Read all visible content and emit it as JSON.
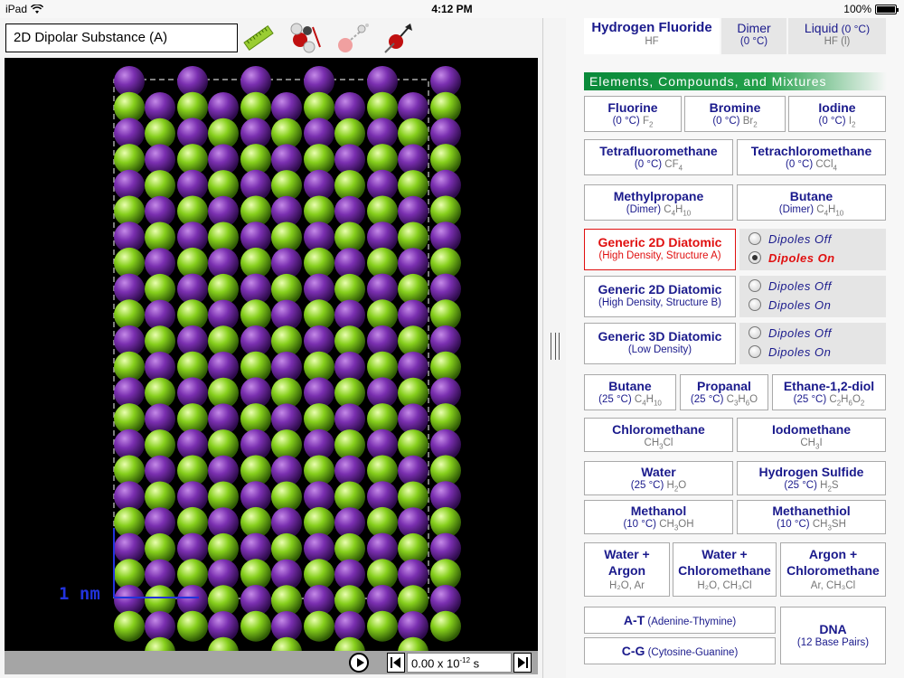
{
  "status": {
    "device": "iPad",
    "time": "4:12 PM",
    "battery": "100%"
  },
  "left": {
    "title": "2D Dipolar Substance (A)",
    "scale_label": "1 nm",
    "time_value": "0.00 x 10",
    "time_exp": "-12",
    "time_unit": " s"
  },
  "top_row": [
    {
      "name": "Hydrogen Fluoride",
      "sub": "HF"
    },
    {
      "name": "Dimer",
      "sub": "(0 °C)"
    },
    {
      "name": "Liquid",
      "name_extra": " (0 °C)",
      "sub": "HF (l)"
    }
  ],
  "section_title": "Elements, Compounds, and Mixtures",
  "row1": [
    {
      "name": "Fluorine",
      "cond": "(0 °C)",
      "f1": "F",
      "f1s": "2"
    },
    {
      "name": "Bromine",
      "cond": "(0 °C)",
      "f1": "Br",
      "f1s": "2"
    },
    {
      "name": "Iodine",
      "cond": "(0 °C)",
      "f1": "I",
      "f1s": "2"
    }
  ],
  "row2": [
    {
      "name": "Tetrafluoromethane",
      "cond": "(0 °C)",
      "f1": "CF",
      "f1s": "4"
    },
    {
      "name": "Tetrachloromethane",
      "cond": "(0 °C)",
      "f1": "CCl",
      "f1s": "4"
    }
  ],
  "row3": [
    {
      "name": "Methylpropane",
      "cond": "(Dimer)",
      "f1": "C",
      "f1s": "4",
      "f2": "H",
      "f2s": "10"
    },
    {
      "name": "Butane",
      "cond": "(Dimer)",
      "f1": "C",
      "f1s": "4",
      "f2": "H",
      "f2s": "10"
    }
  ],
  "diatomic": [
    {
      "name": "Generic 2D Diatomic",
      "sub": "(High Density, Structure A)",
      "off": "Dipoles Off",
      "on": "Dipoles On"
    },
    {
      "name": "Generic 2D Diatomic",
      "sub": "(High Density, Structure B)",
      "off": "Dipoles Off",
      "on": "Dipoles On"
    },
    {
      "name": "Generic 3D Diatomic",
      "sub": "(Low Density)",
      "off": "Dipoles Off",
      "on": "Dipoles On"
    }
  ],
  "row4": [
    {
      "name": "Butane",
      "cond": "(25 °C)",
      "f1": "C",
      "f1s": "4",
      "f2": "H",
      "f2s": "10"
    },
    {
      "name": "Propanal",
      "cond": "(25 °C)",
      "f1": "C",
      "f1s": "3",
      "f2": "H",
      "f2s": "6",
      "f3": "O"
    },
    {
      "name": "Ethane-1,2-diol",
      "cond": "(25 °C)",
      "f1": "C",
      "f1s": "2",
      "f2": "H",
      "f2s": "6",
      "f3": "O",
      "f3s": "2"
    }
  ],
  "row5": [
    {
      "name": "Chloromethane",
      "f1": "CH",
      "f1s": "3",
      "f2": "Cl"
    },
    {
      "name": "Iodomethane",
      "f1": "CH",
      "f1s": "3",
      "f2": "I"
    }
  ],
  "row6": [
    {
      "name": "Water",
      "cond": "(25 °C)",
      "f1": "H",
      "f1s": "2",
      "f2": "O"
    },
    {
      "name": "Hydrogen Sulfide",
      "cond": "(25 °C)",
      "f1": "H",
      "f1s": "2",
      "f2": "S"
    }
  ],
  "row7": [
    {
      "name": "Methanol",
      "cond": "(10 °C)",
      "f1": "CH",
      "f1s": "3",
      "f2": "OH"
    },
    {
      "name": "Methanethiol",
      "cond": "(10 °C)",
      "f1": "CH",
      "f1s": "3",
      "f2": "SH"
    }
  ],
  "row8": [
    {
      "name1": "Water +",
      "name2": "Argon",
      "sub": "H₂O, Ar"
    },
    {
      "name1": "Water +",
      "name2": "Chloromethane",
      "sub": "H₂O, CH₃Cl"
    },
    {
      "name1": "Argon +",
      "name2": "Chloromethane",
      "sub": "Ar, CH₃Cl"
    }
  ],
  "dna": [
    {
      "name": "A-T",
      "sub": " (Adenine-Thymine)"
    },
    {
      "name": "C-G",
      "sub": " (Cytosine-Guanine)"
    },
    {
      "name": "DNA",
      "sub": "(12 Base Pairs)"
    }
  ],
  "colors": {
    "purple_atom": "#7a2fb0",
    "green_atom": "#8ad21e",
    "accent_red": "#e01010",
    "text_blue": "#1a1a8c",
    "header_green": "#0a8a3a"
  }
}
